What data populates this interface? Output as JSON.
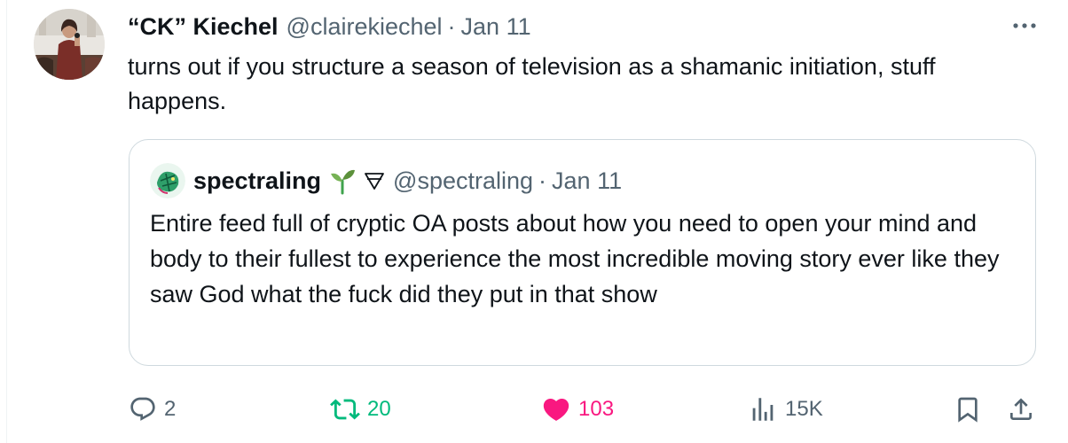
{
  "tweet": {
    "display_name": "“CK” Kiechel",
    "handle": "@clairekiechel",
    "separator": "·",
    "date": "Jan 11",
    "text": "turns out if you structure a season of television as a shamanic initiation, stuff happens."
  },
  "quoted_tweet": {
    "display_name": "spectraling",
    "name_emoji": "seedling",
    "name_symbol": "alchemical-symbol",
    "handle": "@spectraling",
    "separator": "·",
    "date": "Jan 11",
    "text": "Entire feed full of cryptic OA posts about how you need to open your mind and body to their fullest to experience the most incredible moving story ever like they saw God what the fuck did they put in that show"
  },
  "actions": {
    "reply": {
      "icon": "reply-icon",
      "count": "2",
      "color": "#536471"
    },
    "retweet": {
      "icon": "retweet-icon",
      "count": "20",
      "color": "#00ba7c"
    },
    "like": {
      "icon": "heart-icon",
      "count": "103",
      "color": "#f91880"
    },
    "views": {
      "icon": "views-icon",
      "count": "15K",
      "color": "#536471"
    },
    "bookmark": {
      "icon": "bookmark-icon"
    },
    "share": {
      "icon": "share-icon"
    }
  },
  "colors": {
    "text": "#0f1419",
    "secondary": "#536471",
    "border": "#cfd9de",
    "retweet_green": "#00ba7c",
    "like_pink": "#f91880"
  }
}
